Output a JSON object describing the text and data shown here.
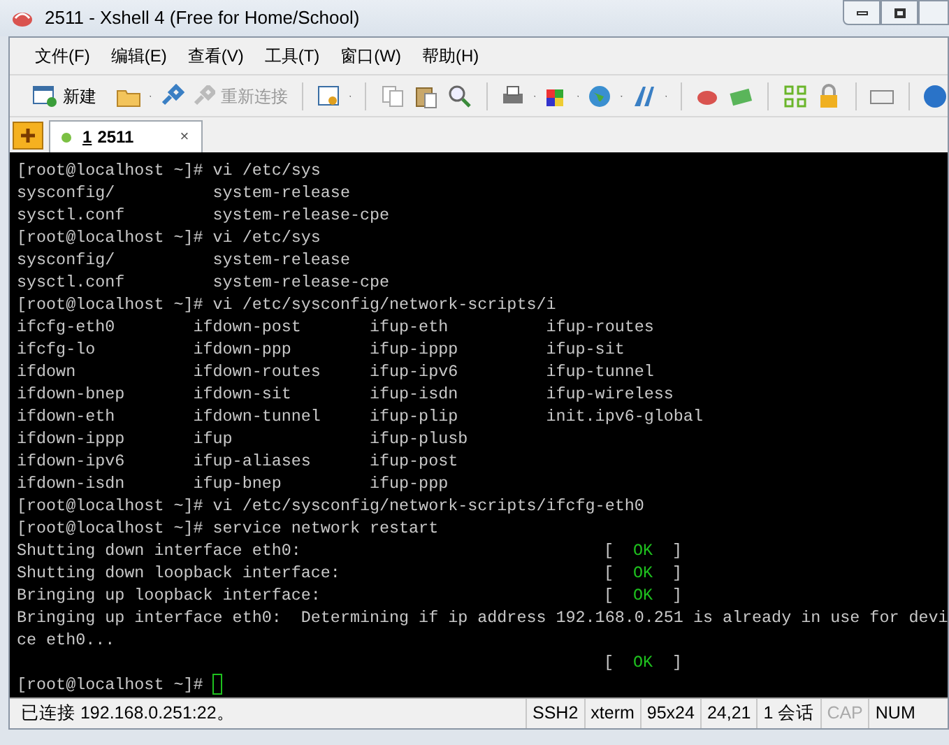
{
  "window": {
    "title": "2511 - Xshell 4 (Free for Home/School)"
  },
  "menu": [
    "文件(F)",
    "编辑(E)",
    "查看(V)",
    "工具(T)",
    "窗口(W)",
    "帮助(H)"
  ],
  "toolbar": [
    {
      "label": "新建",
      "disabled": false
    },
    {
      "label": "重新连接",
      "disabled": true
    }
  ],
  "tabs": [
    {
      "number": "1",
      "label": "2511",
      "selected": true,
      "close": "×"
    }
  ],
  "terminal": {
    "lines": [
      {
        "text": "[root@localhost ~]# vi /etc/sys"
      },
      {
        "text": "sysconfig/          system-release"
      },
      {
        "text": "sysctl.conf         system-release-cpe"
      },
      {
        "text": "[root@localhost ~]# vi /etc/sys"
      },
      {
        "text": "sysconfig/          system-release"
      },
      {
        "text": "sysctl.conf         system-release-cpe"
      },
      {
        "text": "[root@localhost ~]# vi /etc/sysconfig/network-scripts/i"
      },
      {
        "text": "ifcfg-eth0        ifdown-post       ifup-eth          ifup-routes"
      },
      {
        "text": "ifcfg-lo          ifdown-ppp        ifup-ippp         ifup-sit"
      },
      {
        "text": "ifdown            ifdown-routes     ifup-ipv6         ifup-tunnel"
      },
      {
        "text": "ifdown-bnep       ifdown-sit        ifup-isdn         ifup-wireless"
      },
      {
        "text": "ifdown-eth        ifdown-tunnel     ifup-plip         init.ipv6-global"
      },
      {
        "text": "ifdown-ippp       ifup              ifup-plusb"
      },
      {
        "text": "ifdown-ipv6       ifup-aliases      ifup-post"
      },
      {
        "text": "ifdown-isdn       ifup-bnep         ifup-ppp"
      },
      {
        "text": "[root@localhost ~]# vi /etc/sysconfig/network-scripts/ifcfg-eth0"
      },
      {
        "text": "[root@localhost ~]# service network restart"
      },
      {
        "text": "Shutting down interface eth0:",
        "open": "[",
        "status": "OK",
        "close": "]"
      },
      {
        "text": "Shutting down loopback interface:",
        "open": "[",
        "status": "OK",
        "close": "]"
      },
      {
        "text": "Bringing up loopback interface:",
        "open": "[",
        "status": "OK",
        "close": "]"
      },
      {
        "text": "Bringing up interface eth0:  Determining if ip address 192.168.0.251 is already in use for devi"
      },
      {
        "text": "ce eth0..."
      },
      {
        "open": "[",
        "status": "OK",
        "close": "]"
      },
      {
        "text": "[root@localhost ~]# ",
        "cursor": true
      }
    ]
  },
  "status_bar": {
    "message": "已连接 192.168.0.251:22。",
    "cells": [
      {
        "text": "SSH2",
        "disabled": false
      },
      {
        "text": "xterm",
        "disabled": false
      },
      {
        "text": "95x24",
        "disabled": false
      },
      {
        "text": "24,21",
        "disabled": false
      },
      {
        "text": "1 会话",
        "disabled": false
      },
      {
        "text": "CAP",
        "disabled": true
      },
      {
        "text": "NUM",
        "disabled": false
      }
    ]
  }
}
